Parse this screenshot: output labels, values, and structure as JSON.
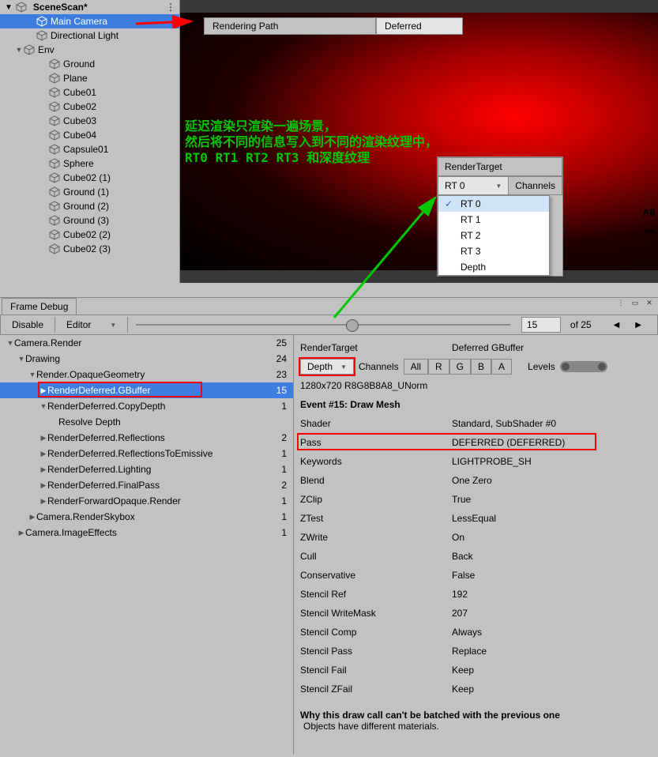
{
  "hierarchy": {
    "tab_title": "SceneScan*",
    "items": [
      {
        "label": "Main Camera",
        "indent": 1,
        "selected": true,
        "toggle": ""
      },
      {
        "label": "Directional Light",
        "indent": 1,
        "selected": false,
        "toggle": ""
      },
      {
        "label": "Env",
        "indent": 0,
        "selected": false,
        "toggle": "▼"
      },
      {
        "label": "Ground",
        "indent": 2,
        "selected": false,
        "toggle": ""
      },
      {
        "label": "Plane",
        "indent": 2,
        "selected": false,
        "toggle": ""
      },
      {
        "label": "Cube01",
        "indent": 2,
        "selected": false,
        "toggle": ""
      },
      {
        "label": "Cube02",
        "indent": 2,
        "selected": false,
        "toggle": ""
      },
      {
        "label": "Cube03",
        "indent": 2,
        "selected": false,
        "toggle": ""
      },
      {
        "label": "Cube04",
        "indent": 2,
        "selected": false,
        "toggle": ""
      },
      {
        "label": "Capsule01",
        "indent": 2,
        "selected": false,
        "toggle": ""
      },
      {
        "label": "Sphere",
        "indent": 2,
        "selected": false,
        "toggle": ""
      },
      {
        "label": "Cube02 (1)",
        "indent": 2,
        "selected": false,
        "toggle": ""
      },
      {
        "label": "Ground (1)",
        "indent": 2,
        "selected": false,
        "toggle": ""
      },
      {
        "label": "Ground (2)",
        "indent": 2,
        "selected": false,
        "toggle": ""
      },
      {
        "label": "Ground (3)",
        "indent": 2,
        "selected": false,
        "toggle": ""
      },
      {
        "label": "Cube02 (2)",
        "indent": 2,
        "selected": false,
        "toggle": ""
      },
      {
        "label": "Cube02 (3)",
        "indent": 2,
        "selected": false,
        "toggle": ""
      }
    ]
  },
  "scene": {
    "prop_label": "Rendering Path",
    "prop_value": "Deferred",
    "green_text": "延迟渲染只渲染一遍场景，\n然后将不同的信息写入到不同的渲染纹理中，\nRT0 RT1 RT2 RT3 和深度纹理"
  },
  "rt_popup": {
    "header": "RenderTarget",
    "selected": "RT 0",
    "channels_label": "Channels",
    "a8": "A8",
    "es": "es",
    "items": [
      "RT 0",
      "RT 1",
      "RT 2",
      "RT 3",
      "Depth"
    ]
  },
  "frame_debug": {
    "tab": "Frame Debug",
    "disable": "Disable",
    "editor": "Editor",
    "current": "15",
    "total": "of 25",
    "tree": [
      {
        "label": "Camera.Render",
        "indent": 0,
        "count": "25",
        "toggle": "▼",
        "sel": false
      },
      {
        "label": "Drawing",
        "indent": 1,
        "count": "24",
        "toggle": "▼",
        "sel": false
      },
      {
        "label": "Render.OpaqueGeometry",
        "indent": 2,
        "count": "23",
        "toggle": "▼",
        "sel": false
      },
      {
        "label": "RenderDeferred.GBuffer",
        "indent": 3,
        "count": "15",
        "toggle": "▶",
        "sel": true
      },
      {
        "label": "RenderDeferred.CopyDepth",
        "indent": 3,
        "count": "1",
        "toggle": "▼",
        "sel": false
      },
      {
        "label": "Resolve Depth",
        "indent": 4,
        "count": "",
        "toggle": "",
        "sel": false
      },
      {
        "label": "RenderDeferred.Reflections",
        "indent": 3,
        "count": "2",
        "toggle": "▶",
        "sel": false
      },
      {
        "label": "RenderDeferred.ReflectionsToEmissive",
        "indent": 3,
        "count": "1",
        "toggle": "▶",
        "sel": false
      },
      {
        "label": "RenderDeferred.Lighting",
        "indent": 3,
        "count": "1",
        "toggle": "▶",
        "sel": false
      },
      {
        "label": "RenderDeferred.FinalPass",
        "indent": 3,
        "count": "2",
        "toggle": "▶",
        "sel": false
      },
      {
        "label": "RenderForwardOpaque.Render",
        "indent": 3,
        "count": "1",
        "toggle": "▶",
        "sel": false
      },
      {
        "label": "Camera.RenderSkybox",
        "indent": 2,
        "count": "1",
        "toggle": "▶",
        "sel": false
      },
      {
        "label": "Camera.ImageEffects",
        "indent": 1,
        "count": "1",
        "toggle": "▶",
        "sel": false
      }
    ],
    "details": {
      "rt_label": "RenderTarget",
      "rt_value": "Deferred GBuffer",
      "depth_select": "Depth",
      "channels_label": "Channels",
      "channels": [
        "All",
        "R",
        "G",
        "B",
        "A"
      ],
      "levels_label": "Levels",
      "format": "1280x720 R8G8B8A8_UNorm",
      "event_title": "Event #15: Draw Mesh",
      "rows": [
        {
          "k": "Shader",
          "v": "Standard, SubShader #0"
        },
        {
          "k": "Pass",
          "v": "DEFERRED (DEFERRED)"
        },
        {
          "k": "Keywords",
          "v": "LIGHTPROBE_SH"
        },
        {
          "k": "Blend",
          "v": "One Zero"
        },
        {
          "k": "ZClip",
          "v": "True"
        },
        {
          "k": "ZTest",
          "v": "LessEqual"
        },
        {
          "k": "ZWrite",
          "v": "On"
        },
        {
          "k": "Cull",
          "v": "Back"
        },
        {
          "k": "Conservative",
          "v": "False"
        },
        {
          "k": "Stencil Ref",
          "v": "192"
        },
        {
          "k": "Stencil WriteMask",
          "v": "207"
        },
        {
          "k": "Stencil Comp",
          "v": "Always"
        },
        {
          "k": "Stencil Pass",
          "v": "Replace"
        },
        {
          "k": "Stencil Fail",
          "v": "Keep"
        },
        {
          "k": "Stencil ZFail",
          "v": "Keep"
        }
      ],
      "batch_title": "Why this draw call can't be batched with the previous one",
      "batch_reason": "Objects have different materials."
    }
  }
}
